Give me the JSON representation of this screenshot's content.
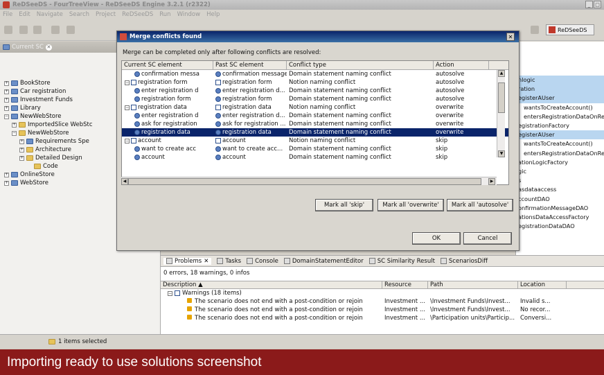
{
  "window": {
    "title": "ReDSeeDS - FourTreeView - ReDSeeDS Engine 3.2.1 (r2322)"
  },
  "menu": [
    "File",
    "Edit",
    "Navigate",
    "Search",
    "Project",
    "ReDSeeDS",
    "Run",
    "Window",
    "Help"
  ],
  "perspective": {
    "label": "ReDSeeDS"
  },
  "left_tab": {
    "label": "Current SC"
  },
  "tree": [
    {
      "label": "BookStore",
      "indent": 0,
      "exp": "+",
      "icon": "folder-blue"
    },
    {
      "label": "Car registration",
      "indent": 0,
      "exp": "+",
      "icon": "folder-blue"
    },
    {
      "label": "Investment Funds",
      "indent": 0,
      "exp": "+",
      "icon": "folder-blue"
    },
    {
      "label": "Library",
      "indent": 0,
      "exp": "+",
      "icon": "folder-blue"
    },
    {
      "label": "NewWebStore",
      "indent": 0,
      "exp": "-",
      "icon": "folder-blue"
    },
    {
      "label": "ImportedSlice WebStc",
      "indent": 1,
      "exp": "+",
      "icon": "folder"
    },
    {
      "label": "NewWebStore",
      "indent": 1,
      "exp": "-",
      "icon": "folder"
    },
    {
      "label": "Requirements Spe",
      "indent": 2,
      "exp": "+",
      "icon": "folder-blue"
    },
    {
      "label": "Architecture",
      "indent": 2,
      "exp": "+",
      "icon": "folder"
    },
    {
      "label": "Detailed Design",
      "indent": 2,
      "exp": "+",
      "icon": "folder"
    },
    {
      "label": "Code",
      "indent": 3,
      "exp": "",
      "icon": "folder"
    },
    {
      "label": "OnlineStore",
      "indent": 0,
      "exp": "+",
      "icon": "folder-blue"
    },
    {
      "label": "WebStore",
      "indent": 0,
      "exp": "+",
      "icon": "folder-blue"
    }
  ],
  "right_list": [
    {
      "text": "nlogic",
      "hl": true
    },
    {
      "text": "ration",
      "hl": true
    },
    {
      "text": "egisterAUser",
      "hl": true
    },
    {
      "text": "wantsToCreateAccount()",
      "hl": false,
      "indent": true
    },
    {
      "text": "entersRegistrationDataOnRe",
      "hl": false,
      "indent": true
    },
    {
      "text": "egistrationFactory",
      "hl": false
    },
    {
      "text": "egisterAUser",
      "hl": true
    },
    {
      "text": "wantsToCreateAccount()",
      "hl": false,
      "indent": true
    },
    {
      "text": "entersRegistrationDataOnRe",
      "hl": false,
      "indent": true
    },
    {
      "text": "ationLogicFactory",
      "hl": false
    },
    {
      "text": "gic",
      "hl": false
    },
    {
      "text": "s",
      "hl": false
    },
    {
      "text": "asdataaccess",
      "hl": false
    },
    {
      "text": "ccountDAO",
      "hl": false
    },
    {
      "text": "onfirmationMessageDAO",
      "hl": false
    },
    {
      "text": "ationsDataAccessFactory",
      "hl": false
    },
    {
      "text": "egistrationDataDAO",
      "hl": false
    }
  ],
  "dialog": {
    "title": "Merge conflicts found",
    "message": "Merge can be completed only after following conflicts are resolved:",
    "columns": [
      "Current SC element",
      "Past SC element",
      "Conflict type",
      "Action"
    ],
    "rows": [
      {
        "cur": "confirmation messa",
        "past": "confirmation message",
        "type": "Domain statement naming conflict",
        "action": "autosolve",
        "level": 1,
        "icon": "round",
        "exp": ""
      },
      {
        "cur": "registration form",
        "past": "registration form",
        "type": "Notion naming conflict",
        "action": "autosolve",
        "level": 0,
        "icon": "square",
        "exp": "-"
      },
      {
        "cur": "enter registration d",
        "past": "enter registration d...",
        "type": "Domain statement naming conflict",
        "action": "autosolve",
        "level": 1,
        "icon": "round",
        "exp": ""
      },
      {
        "cur": "registration form",
        "past": "registration form",
        "type": "Domain statement naming conflict",
        "action": "autosolve",
        "level": 1,
        "icon": "round",
        "exp": ""
      },
      {
        "cur": "registration data",
        "past": "registration data",
        "type": "Notion naming conflict",
        "action": "overwrite",
        "level": 0,
        "icon": "square",
        "exp": "-"
      },
      {
        "cur": "enter registration d",
        "past": "enter registration d...",
        "type": "Domain statement naming conflict",
        "action": "overwrite",
        "level": 1,
        "icon": "round",
        "exp": ""
      },
      {
        "cur": "ask for registration",
        "past": "ask for registration ...",
        "type": "Domain statement naming conflict",
        "action": "overwrite",
        "level": 1,
        "icon": "round",
        "exp": ""
      },
      {
        "cur": "registration data",
        "past": "registration data",
        "type": "Domain statement naming conflict",
        "action": "overwrite",
        "level": 1,
        "icon": "round",
        "exp": "",
        "selected": true
      },
      {
        "cur": "account",
        "past": "account",
        "type": "Notion naming conflict",
        "action": "skip",
        "level": 0,
        "icon": "square",
        "exp": "-"
      },
      {
        "cur": "want to create acc",
        "past": "want to create acc...",
        "type": "Domain statement naming conflict",
        "action": "skip",
        "level": 1,
        "icon": "round",
        "exp": ""
      },
      {
        "cur": "account",
        "past": "account",
        "type": "Domain statement naming conflict",
        "action": "skip",
        "level": 1,
        "icon": "round",
        "exp": ""
      }
    ],
    "buttons": {
      "skip": "Mark all 'skip'",
      "overwrite": "Mark all 'overwrite'",
      "autosolve": "Mark all 'autosolve'",
      "ok": "OK",
      "cancel": "Cancel"
    }
  },
  "bottom": {
    "tabs": [
      "Problems",
      "Tasks",
      "Console",
      "DomainStatementEditor",
      "SC Similarity Result",
      "ScenariosDiff"
    ],
    "summary": "0 errors, 18 warnings, 0 infos",
    "columns": [
      "Description",
      "Resource",
      "Path",
      "Location"
    ],
    "group": "Warnings (18 items)",
    "rows": [
      {
        "desc": "The scenario does not end with a post-condition or rejoin",
        "res": "Investment ...",
        "path": "\\Investment Funds\\Invest...",
        "loc": "Invalid s..."
      },
      {
        "desc": "The scenario does not end with a post-condition or rejoin",
        "res": "Investment ...",
        "path": "\\Investment Funds\\Invest...",
        "loc": "No recor..."
      },
      {
        "desc": "The scenario does not end with a post-condition or rejoin",
        "res": "Investment ...",
        "path": "\\Participation units\\Particip...",
        "loc": "Conversi..."
      }
    ]
  },
  "status": {
    "text": "1 items selected"
  },
  "caption": "Importing ready to use solutions screenshot"
}
